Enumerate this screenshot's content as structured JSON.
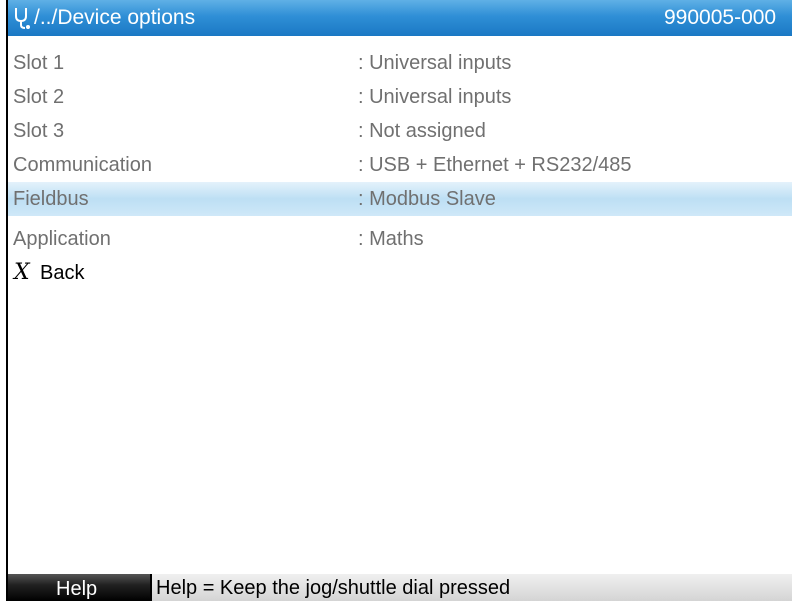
{
  "header": {
    "path": "/../Device options",
    "serial": "990005-000",
    "icon": "diagnostics-icon"
  },
  "items": [
    {
      "label": "Slot 1",
      "value": ": Universal inputs"
    },
    {
      "label": "Slot 2",
      "value": ": Universal inputs"
    },
    {
      "label": "Slot 3",
      "value": ": Not assigned"
    },
    {
      "label": "Communication",
      "value": ": USB + Ethernet + RS232/485"
    },
    {
      "label": "Fieldbus",
      "value": ": Modbus Slave"
    },
    {
      "label": "Application",
      "value": ": Maths"
    }
  ],
  "back": {
    "icon": "X",
    "label": "Back"
  },
  "footer": {
    "help_label": "Help",
    "help_text": "Help = Keep the jog/shuttle dial pressed"
  },
  "colors": {
    "header_bg": "#2f8fd6",
    "selected_bg": "#bddff4",
    "item_text": "#707070"
  }
}
